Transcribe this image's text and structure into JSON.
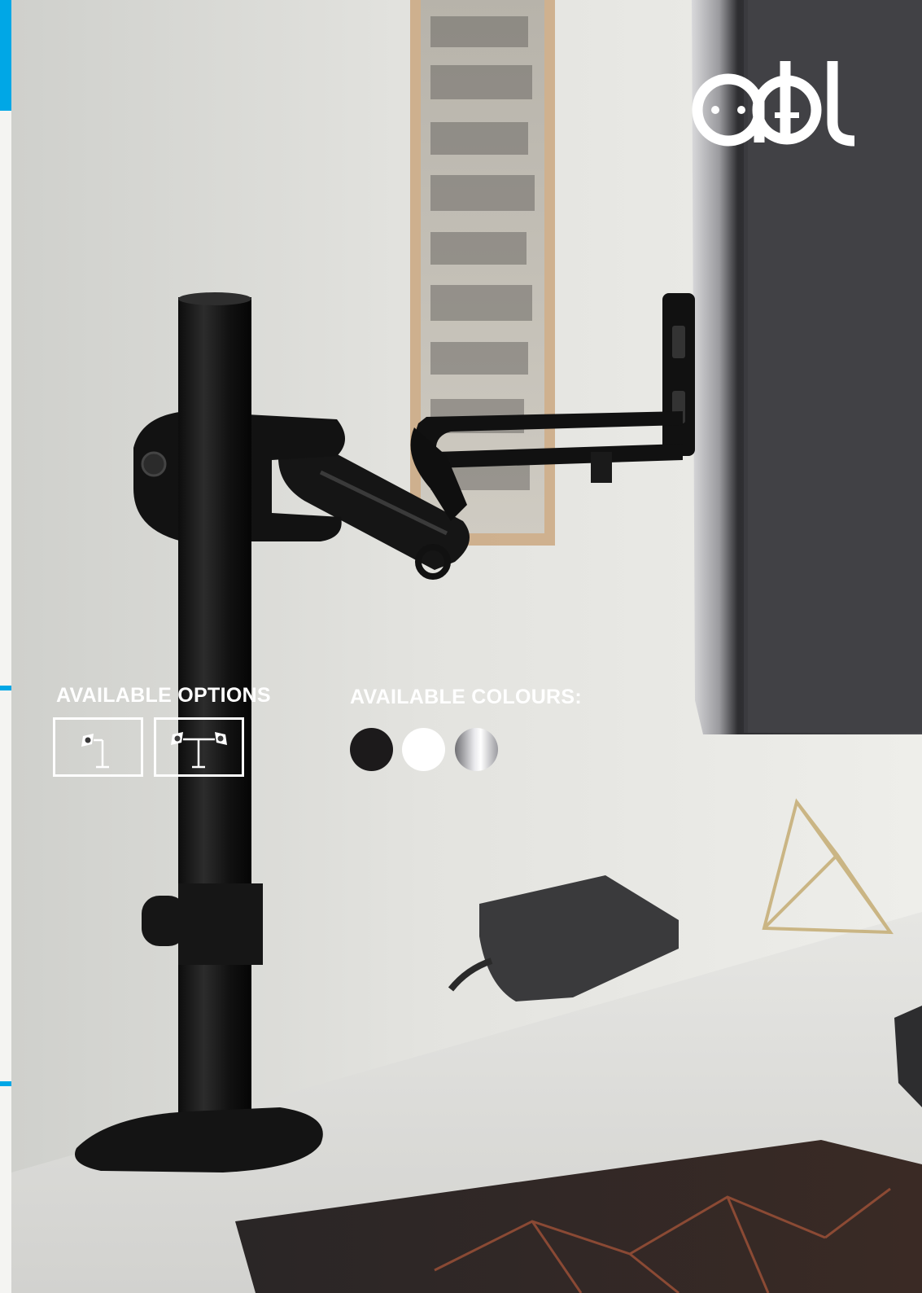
{
  "brand": {
    "logo_text": "abl",
    "logo_icon": "plug-socket-logo"
  },
  "options": {
    "heading": "AVAILABLE OPTIONS",
    "items": [
      {
        "name": "single-monitor-arm",
        "icon": "single-mount-icon"
      },
      {
        "name": "dual-monitor-arm",
        "icon": "dual-mount-icon"
      }
    ]
  },
  "colours": {
    "heading": "AVAILABLE COLOURS:",
    "items": [
      {
        "name": "black",
        "color": "#1c1a1b"
      },
      {
        "name": "white",
        "color": "#ffffff"
      },
      {
        "name": "silver",
        "color": "#b8b8bc"
      }
    ]
  },
  "accent_color": "#00a7e6"
}
